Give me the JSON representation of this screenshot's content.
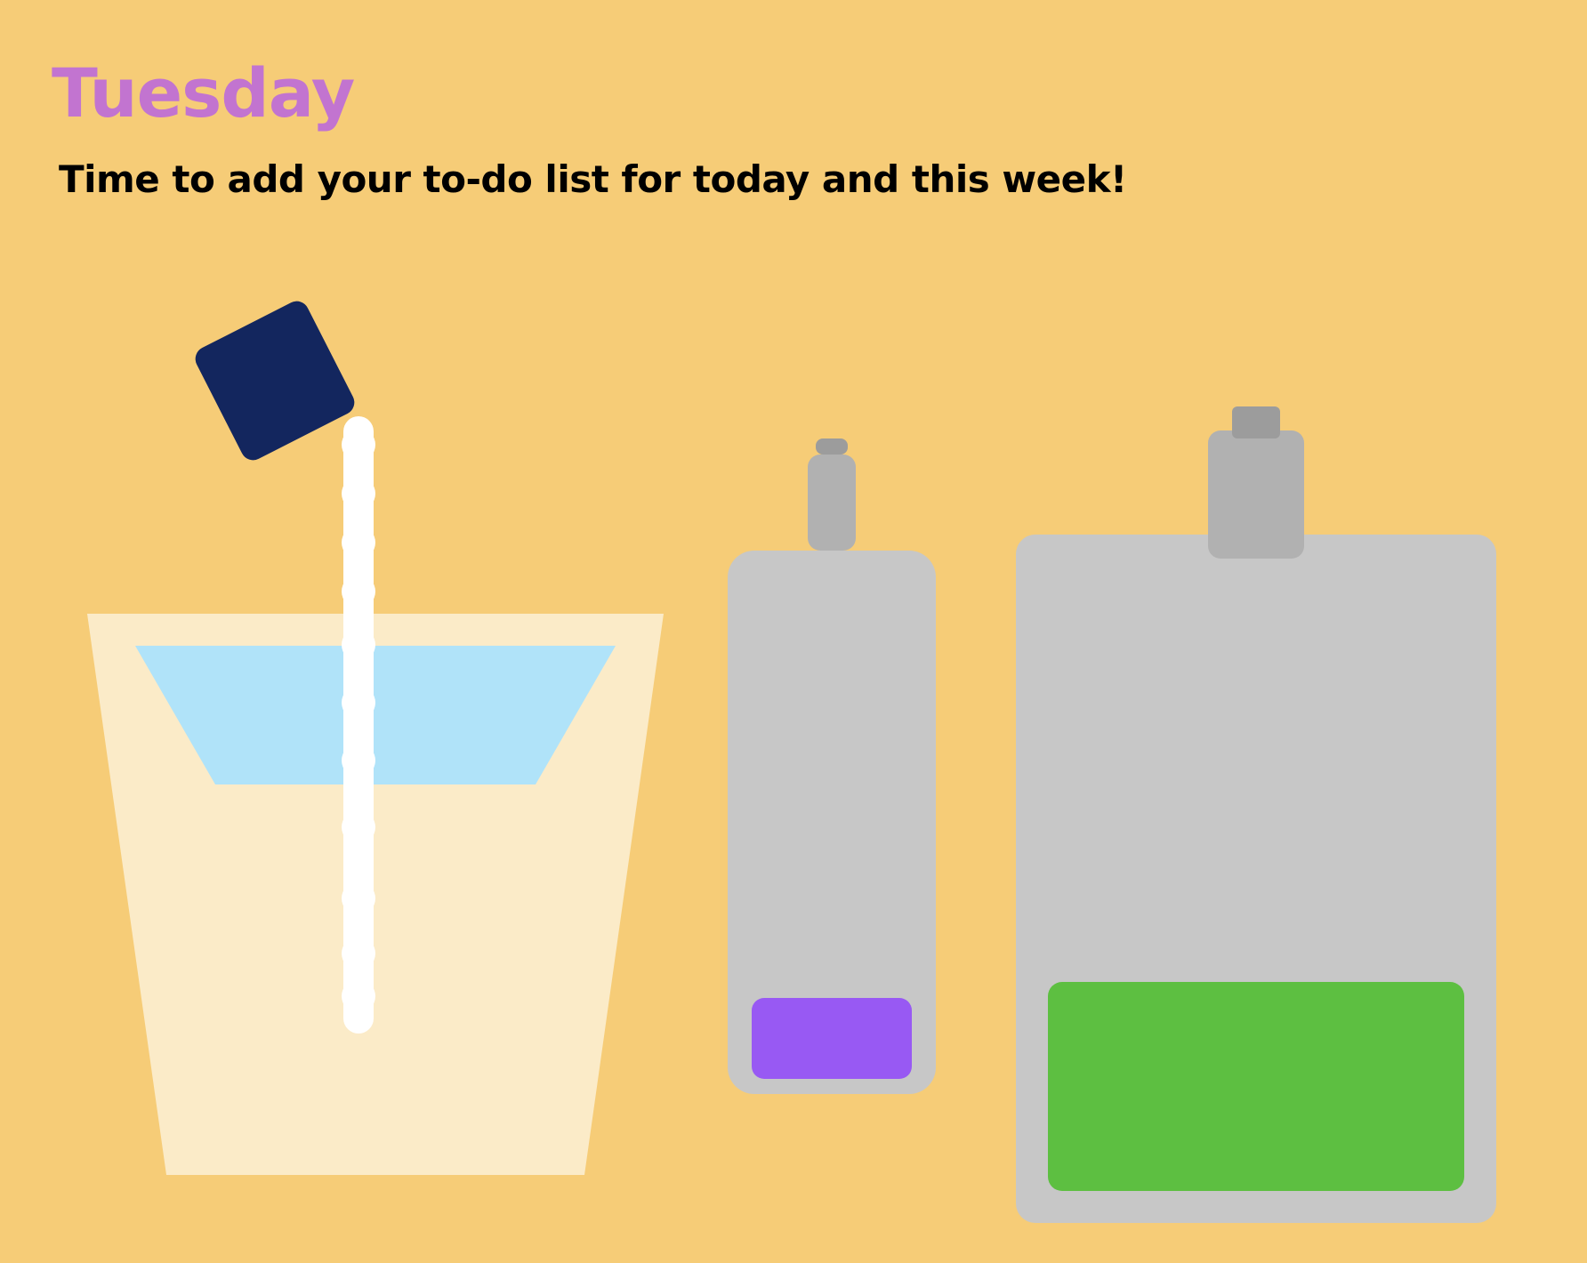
{
  "page": {
    "title": "Tuesday",
    "subtitle": "Time to add your to-do list for today and this week!"
  },
  "colors": {
    "background": "#F6CC77",
    "title": "#C274D0",
    "subtitle": "#000000",
    "cup_body": "#FBEBC8",
    "cup_liquid": "#B0E3F9",
    "carton": "#13265E",
    "pour_stream": "#FFFFFF",
    "bottle_body": "#C7C7C7",
    "bottle_neck": "#B1B1B1",
    "bottle_cap": "#9C9C9C",
    "small_bottle_label": "#9859F3",
    "large_bottle_label": "#5DBF41"
  },
  "illustration": {
    "items": [
      "milk-carton-icon",
      "pour-stream",
      "drinking-cup-icon",
      "small-bottle-icon",
      "large-bottle-icon"
    ]
  }
}
